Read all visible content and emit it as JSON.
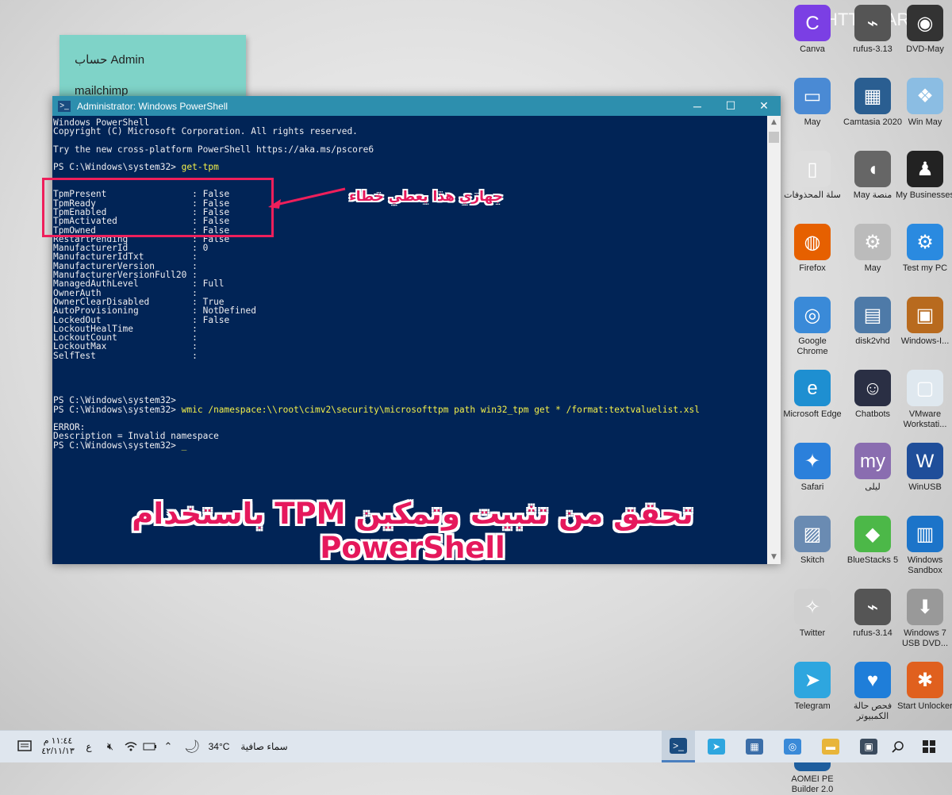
{
  "sticky_note": {
    "line1": "حساب Admin",
    "line2": "mailchimp"
  },
  "partial_text_top": "HTTP://ARAB",
  "desktop_icons": [
    {
      "label": "Canva",
      "icon": "canva-icon",
      "color": "#7b3fe4"
    },
    {
      "label": "rufus-3.13",
      "icon": "usb-drive-icon",
      "color": "#555"
    },
    {
      "label": "DVD-May",
      "icon": "dvd-icon",
      "color": "#333"
    },
    {
      "label": "May",
      "icon": "computer-icon",
      "color": "#4a8ad4"
    },
    {
      "label": "Camtasia 2020",
      "icon": "camtasia-icon",
      "color": "#2a5e91"
    },
    {
      "label": "Win May",
      "icon": "windows-icon",
      "color": "#8bbde3"
    },
    {
      "label": "سلة المحذوفات",
      "icon": "recycle-bin-icon",
      "color": "#ddd"
    },
    {
      "label": "May منصة",
      "icon": "mouse-icon",
      "color": "#666"
    },
    {
      "label": "My Businesses",
      "icon": "businessman-icon",
      "color": "#222"
    },
    {
      "label": "Firefox",
      "icon": "firefox-icon",
      "color": "#e66000"
    },
    {
      "label": "May",
      "icon": "gears-window-icon",
      "color": "#bbb"
    },
    {
      "label": "Test my PC",
      "icon": "test-pc-icon",
      "color": "#2a8ae0"
    },
    {
      "label": "Google Chrome",
      "icon": "chrome-icon",
      "color": "#3a8ad8"
    },
    {
      "label": "disk2vhd",
      "icon": "disk2vhd-icon",
      "color": "#4e7aa8"
    },
    {
      "label": "Windows-I...",
      "icon": "windows-install-icon",
      "color": "#b86a1e"
    },
    {
      "label": "Microsoft Edge",
      "icon": "edge-icon",
      "color": "#1e8fd1"
    },
    {
      "label": "Chatbots",
      "icon": "robot-icon",
      "color": "#2a2f44"
    },
    {
      "label": "VMware Workstati...",
      "icon": "vmware-icon",
      "color": "#dfe8ef"
    },
    {
      "label": "Safari",
      "icon": "safari-icon",
      "color": "#2b80db"
    },
    {
      "label": "ليلى",
      "icon": "my-folder-icon",
      "color": "#8a6db0"
    },
    {
      "label": "WinUSB",
      "icon": "winusb-icon",
      "color": "#1f4e9a"
    },
    {
      "label": "Skitch",
      "icon": "skitch-icon",
      "color": "#6a8bb2"
    },
    {
      "label": "BlueStacks 5",
      "icon": "bluestacks-icon",
      "color": "#4cb848"
    },
    {
      "label": "Windows Sandbox",
      "icon": "sandbox-icon",
      "color": "#1c74c9"
    },
    {
      "label": "Twitter",
      "icon": "twitter-icon",
      "color": "#d0d0d0"
    },
    {
      "label": "rufus-3.14",
      "icon": "usb-drive-icon",
      "color": "#555"
    },
    {
      "label": "Windows 7 USB DVD...",
      "icon": "usb-dvd-tool-icon",
      "color": "#999"
    },
    {
      "label": "Telegram",
      "icon": "telegram-icon",
      "color": "#2ea6df"
    },
    {
      "label": "فحص حالة الكمبيوتر",
      "icon": "health-check-icon",
      "color": "#1f7ed9"
    },
    {
      "label": "Start Unlocker",
      "icon": "unlocker-icon",
      "color": "#e0601e"
    },
    {
      "label": "AOMEI PE Builder 2.0",
      "icon": "aomei-icon",
      "color": "#1e5e9e"
    }
  ],
  "window": {
    "title": "Administrator: Windows PowerShell",
    "minimize": "─",
    "maximize": "☐",
    "close": "✕"
  },
  "console_lines": [
    {
      "text": "Windows PowerShell"
    },
    {
      "text": "Copyright (C) Microsoft Corporation. All rights reserved."
    },
    {
      "text": ""
    },
    {
      "text": "Try the new cross-platform PowerShell https://aka.ms/pscore6"
    },
    {
      "text": ""
    },
    {
      "text": "PS C:\\Windows\\system32> ",
      "cmd": "get-tpm"
    },
    {
      "text": ""
    },
    {
      "text": ""
    },
    {
      "text": "TpmPresent                : False"
    },
    {
      "text": "TpmReady                  : False"
    },
    {
      "text": "TpmEnabled                : False"
    },
    {
      "text": "TpmActivated              : False"
    },
    {
      "text": "TpmOwned                  : False"
    },
    {
      "text": "RestartPending            : False"
    },
    {
      "text": "ManufacturerId            : 0"
    },
    {
      "text": "ManufacturerIdTxt         :"
    },
    {
      "text": "ManufacturerVersion       :"
    },
    {
      "text": "ManufacturerVersionFull20 :"
    },
    {
      "text": "ManagedAuthLevel          : Full"
    },
    {
      "text": "OwnerAuth                 :"
    },
    {
      "text": "OwnerClearDisabled        : True"
    },
    {
      "text": "AutoProvisioning          : NotDefined"
    },
    {
      "text": "LockedOut                 : False"
    },
    {
      "text": "LockoutHealTime           :"
    },
    {
      "text": "LockoutCount              :"
    },
    {
      "text": "LockoutMax                :"
    },
    {
      "text": "SelfTest                  :"
    },
    {
      "text": ""
    },
    {
      "text": ""
    },
    {
      "text": ""
    },
    {
      "text": ""
    },
    {
      "text": "PS C:\\Windows\\system32>"
    },
    {
      "text": "PS C:\\Windows\\system32> ",
      "cmd": "wmic /namespace:\\\\root\\cimv2\\security\\microsofttpm path win32_tpm get * /format:textvaluelist.xsl"
    },
    {
      "text": ""
    },
    {
      "text": "ERROR:"
    },
    {
      "text": "Description = Invalid namespace"
    },
    {
      "text": "PS C:\\Windows\\system32> ",
      "cmd": "_"
    }
  ],
  "annotation_text": "جهازي هذا يعطي خطاء",
  "headline": "تحقق من تثبيت وتمكين TPM باستخدام PowerShell",
  "taskbar": {
    "time": "١١:٤٤ م",
    "date": "٤٢/١١/١٣",
    "language": "ع",
    "temperature": "34°C",
    "weather_text": "سماء صافية",
    "apps": [
      {
        "name": "powershell",
        "icon": "powershell-icon",
        "color": "#1a4c80",
        "active": true
      },
      {
        "name": "telegram",
        "icon": "telegram-icon",
        "color": "#2ea6df",
        "active": false
      },
      {
        "name": "network-tool",
        "icon": "network-tool-icon",
        "color": "#3b6ea8",
        "active": false
      },
      {
        "name": "chrome",
        "icon": "chrome-icon",
        "color": "#3a8ad8",
        "active": false
      },
      {
        "name": "file-explorer",
        "icon": "folder-icon",
        "color": "#e8b53a",
        "active": false
      },
      {
        "name": "store",
        "icon": "store-icon",
        "color": "#3b4b5e",
        "active": false
      }
    ]
  }
}
